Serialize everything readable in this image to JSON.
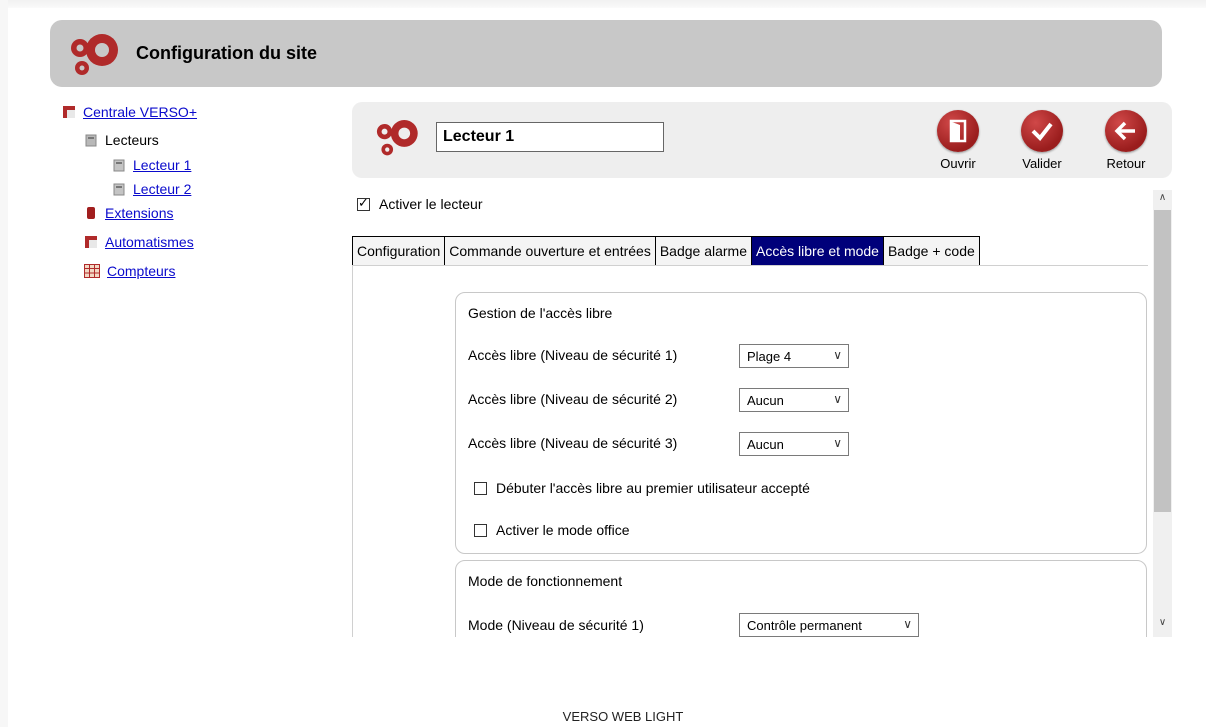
{
  "header": {
    "title": "Configuration du site",
    "logo_icon": "gears-icon"
  },
  "tree": {
    "root": "Centrale VERSO+",
    "lecteurs": "Lecteurs",
    "lecteur1": "Lecteur 1",
    "lecteur2": "Lecteur 2",
    "extensions": "Extensions",
    "automatismes": "Automatismes",
    "compteurs": "Compteurs"
  },
  "panel": {
    "name_value": "Lecteur 1",
    "actions": {
      "open": "Ouvrir",
      "validate": "Valider",
      "back": "Retour"
    },
    "enable_label": "Activer le lecteur",
    "enable_checked": true
  },
  "tabs": [
    "Configuration",
    "Commande ouverture et entrées",
    "Badge alarme",
    "Accès libre et mode",
    "Badge + code"
  ],
  "active_tab": "Accès libre et mode",
  "free_access": {
    "title": "Gestion de l'accès libre",
    "rows": [
      {
        "label": "Accès libre (Niveau de sécurité 1)",
        "value": "Plage 4"
      },
      {
        "label": "Accès libre (Niveau de sécurité 2)",
        "value": "Aucun"
      },
      {
        "label": "Accès libre (Niveau de sécurité 3)",
        "value": "Aucun"
      }
    ],
    "check_first_user": "Débuter l'accès libre au premier utilisateur accepté",
    "check_office": "Activer le mode office"
  },
  "mode": {
    "title": "Mode de fonctionnement",
    "row_label": "Mode (Niveau de sécurité 1)",
    "row_value": "Contrôle permanent"
  },
  "footer": "VERSO WEB LIGHT",
  "colors": {
    "accent": "#00007a",
    "brand_red": "#b02a2a",
    "link": "#0a0acc"
  }
}
